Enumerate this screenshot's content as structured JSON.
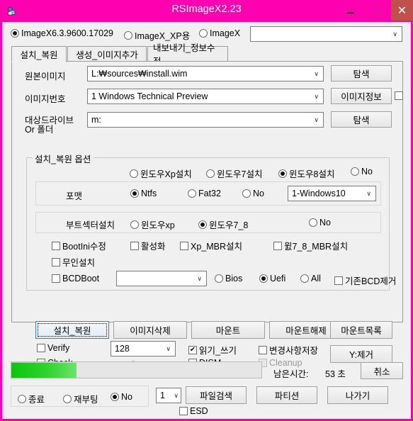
{
  "window": {
    "title": "RSImageX2.23",
    "icon": "app-icon",
    "minimize_label": "–",
    "maximize_label": "□",
    "close_label": "✕",
    "accent_color": "#ff00b0",
    "close_button_color": "#c0504d"
  },
  "engine_row": {
    "options": [
      {
        "label": "ImageX6.3.9600.17029",
        "selected": true
      },
      {
        "label": "ImageX_XP용",
        "selected": false
      },
      {
        "label": "ImageX",
        "selected": false
      }
    ],
    "combo_value": "",
    "combo_arrow": "∨"
  },
  "tabs": [
    {
      "label": "설치_복원",
      "active": true
    },
    {
      "label": "생성_이미지추가",
      "active": false
    },
    {
      "label": "내보내기_정보수정",
      "active": false
    }
  ],
  "form": {
    "source_image": {
      "label": "원본이미지",
      "value": "L:₩sources₩install.wim",
      "button": "탐색"
    },
    "image_number": {
      "label": "이미지번호",
      "value": "1   Windows Technical Preview",
      "button": "이미지정보",
      "extra_checkbox": ""
    },
    "target_drive": {
      "label_line1": "대상드라이브",
      "label_line2": "Or 폴더",
      "value": "m:",
      "button": "탐색"
    }
  },
  "options_group": {
    "title": "설치_복원 옵션",
    "install_type": [
      {
        "label": "윈도우Xp설치",
        "selected": false
      },
      {
        "label": "윈도우7설치",
        "selected": false
      },
      {
        "label": "윈도우8설치",
        "selected": true
      },
      {
        "label": "No",
        "selected": false
      }
    ],
    "format": {
      "label": "포맷",
      "options": [
        {
          "label": "Ntfs",
          "selected": true
        },
        {
          "label": "Fat32",
          "selected": false
        },
        {
          "label": "No",
          "selected": false
        }
      ],
      "combo_value": "1-Windows10"
    },
    "bootsector": {
      "label": "부트섹터설치",
      "options": [
        {
          "label": "윈도우xp",
          "selected": false
        },
        {
          "label": "윈도우7_8",
          "selected": true
        },
        {
          "label": "No",
          "selected": false
        }
      ]
    },
    "checkboxes": [
      {
        "label": "BootIni수정",
        "checked": false
      },
      {
        "label": "활성화",
        "checked": false
      },
      {
        "label": "Xp_MBR설치",
        "checked": false
      },
      {
        "label": "윐7_8_MBR설치",
        "checked": false
      },
      {
        "label": "무인설치",
        "checked": false
      }
    ],
    "bcdboot": {
      "label": "BCDBoot",
      "checked": false,
      "combo_value": "",
      "firmware": [
        {
          "label": "Bios",
          "selected": false
        },
        {
          "label": "Uefi",
          "selected": true
        },
        {
          "label": "All",
          "selected": false
        }
      ],
      "remove_bcd": {
        "label": "기존BCD제거",
        "checked": false
      }
    }
  },
  "action_row": {
    "buttons": [
      {
        "label": "설치_복원",
        "focused": true
      },
      {
        "label": "이미지삭제",
        "focused": false
      },
      {
        "label": "마운트",
        "focused": false
      },
      {
        "label": "마운트해제",
        "focused": false
      },
      {
        "label": "마운트목록",
        "focused": false
      }
    ],
    "verify": {
      "label": "Verify",
      "checked": false
    },
    "check": {
      "label": "Check",
      "checked": false
    },
    "size_combo": {
      "value": "128",
      "caption": "Y:크기(MB)"
    },
    "readwrite": {
      "label": "읽기_쓰기",
      "checked": true
    },
    "dism": {
      "label": "DISM",
      "checked": false
    },
    "save_changes": {
      "label": "변경사항저장",
      "checked": false
    },
    "cleanup": {
      "label": "Cleanup",
      "checked": false,
      "disabled": true
    },
    "y_remove_button": "Y:제거"
  },
  "status": {
    "progress_percent": 26,
    "progress_color": "#1ec41e",
    "time_label": "남은시간:",
    "time_value": "53 초",
    "cancel_button": "취소"
  },
  "footer": {
    "post_action": [
      {
        "label": "종료",
        "selected": false
      },
      {
        "label": "재부팅",
        "selected": false
      },
      {
        "label": "No",
        "selected": true
      }
    ],
    "count_combo": "1",
    "buttons": [
      {
        "label": "파일검색"
      },
      {
        "label": "파티션"
      },
      {
        "label": "나가기"
      }
    ],
    "esd": {
      "label": "ESD",
      "checked": false
    }
  }
}
